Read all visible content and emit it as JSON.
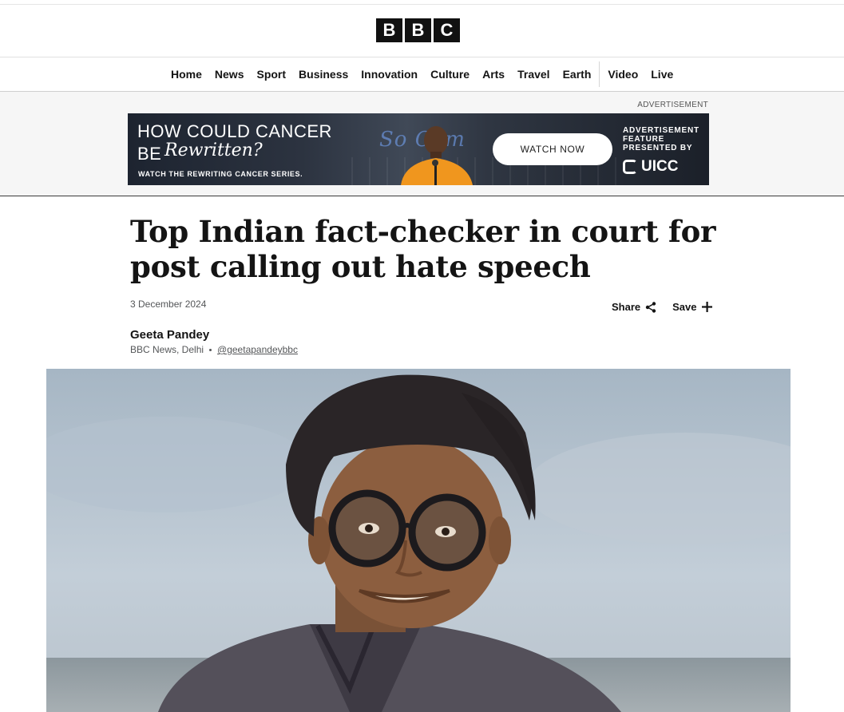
{
  "header": {
    "logo_letters": [
      "B",
      "B",
      "C"
    ]
  },
  "nav": {
    "items": [
      "Home",
      "News",
      "Sport",
      "Business",
      "Innovation",
      "Culture",
      "Arts",
      "Travel",
      "Earth",
      "Video",
      "Live"
    ]
  },
  "ad": {
    "label": "ADVERTISEMENT",
    "headline_line1": "HOW COULD CANCER",
    "headline_line2_prefix": "BE",
    "headline_script": "Rewritten?",
    "subline": "WATCH THE REWRITING CANCER SERIES.",
    "cta": "WATCH NOW",
    "feature_line1": "ADVERTISEMENT",
    "feature_line2": "FEATURE",
    "feature_line3": "PRESENTED BY",
    "sponsor": "UICC"
  },
  "article": {
    "title": "Top Indian fact-checker in court for post calling out hate speech",
    "date": "3 December 2024",
    "share_label": "Share",
    "save_label": "Save",
    "author": "Geeta Pandey",
    "outlet": "BBC News, Delhi",
    "handle": "@geetapandeybbc"
  },
  "colors": {
    "text": "#141414",
    "secondary_text": "#545658",
    "logo_block": "#111111"
  }
}
